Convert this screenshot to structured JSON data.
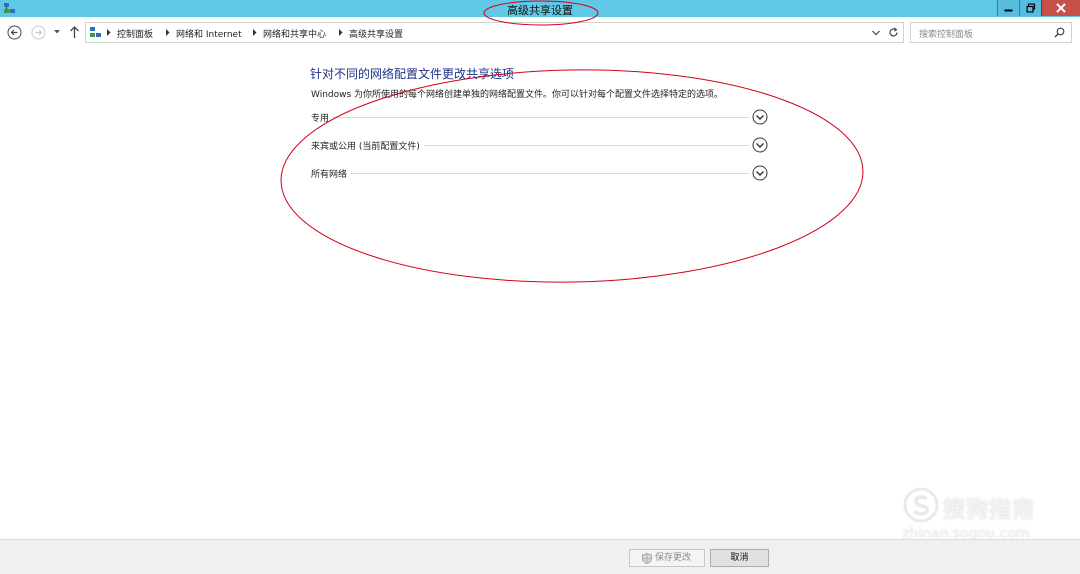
{
  "window": {
    "title": "高级共享设置"
  },
  "nav": {
    "breadcrumb": [
      "控制面板",
      "网络和 Internet",
      "网络和共享中心",
      "高级共享设置"
    ],
    "search_placeholder": "搜索控制面板"
  },
  "main": {
    "heading": "针对不同的网络配置文件更改共享选项",
    "description": "Windows 为你所使用的每个网络创建单独的网络配置文件。你可以针对每个配置文件选择特定的选项。",
    "sections": [
      {
        "label": "专用"
      },
      {
        "label": "来宾或公用 (当前配置文件)"
      },
      {
        "label": "所有网络"
      }
    ]
  },
  "footer": {
    "save_label": "保存更改",
    "cancel_label": "取消"
  },
  "watermark": {
    "text": "搜狗指南",
    "url": "zhinan.sogou.com"
  },
  "colors": {
    "titlebar": "#5fc8e6",
    "close_button": "#c7504a",
    "heading": "#1e3287",
    "annotation": "#d0021b"
  }
}
